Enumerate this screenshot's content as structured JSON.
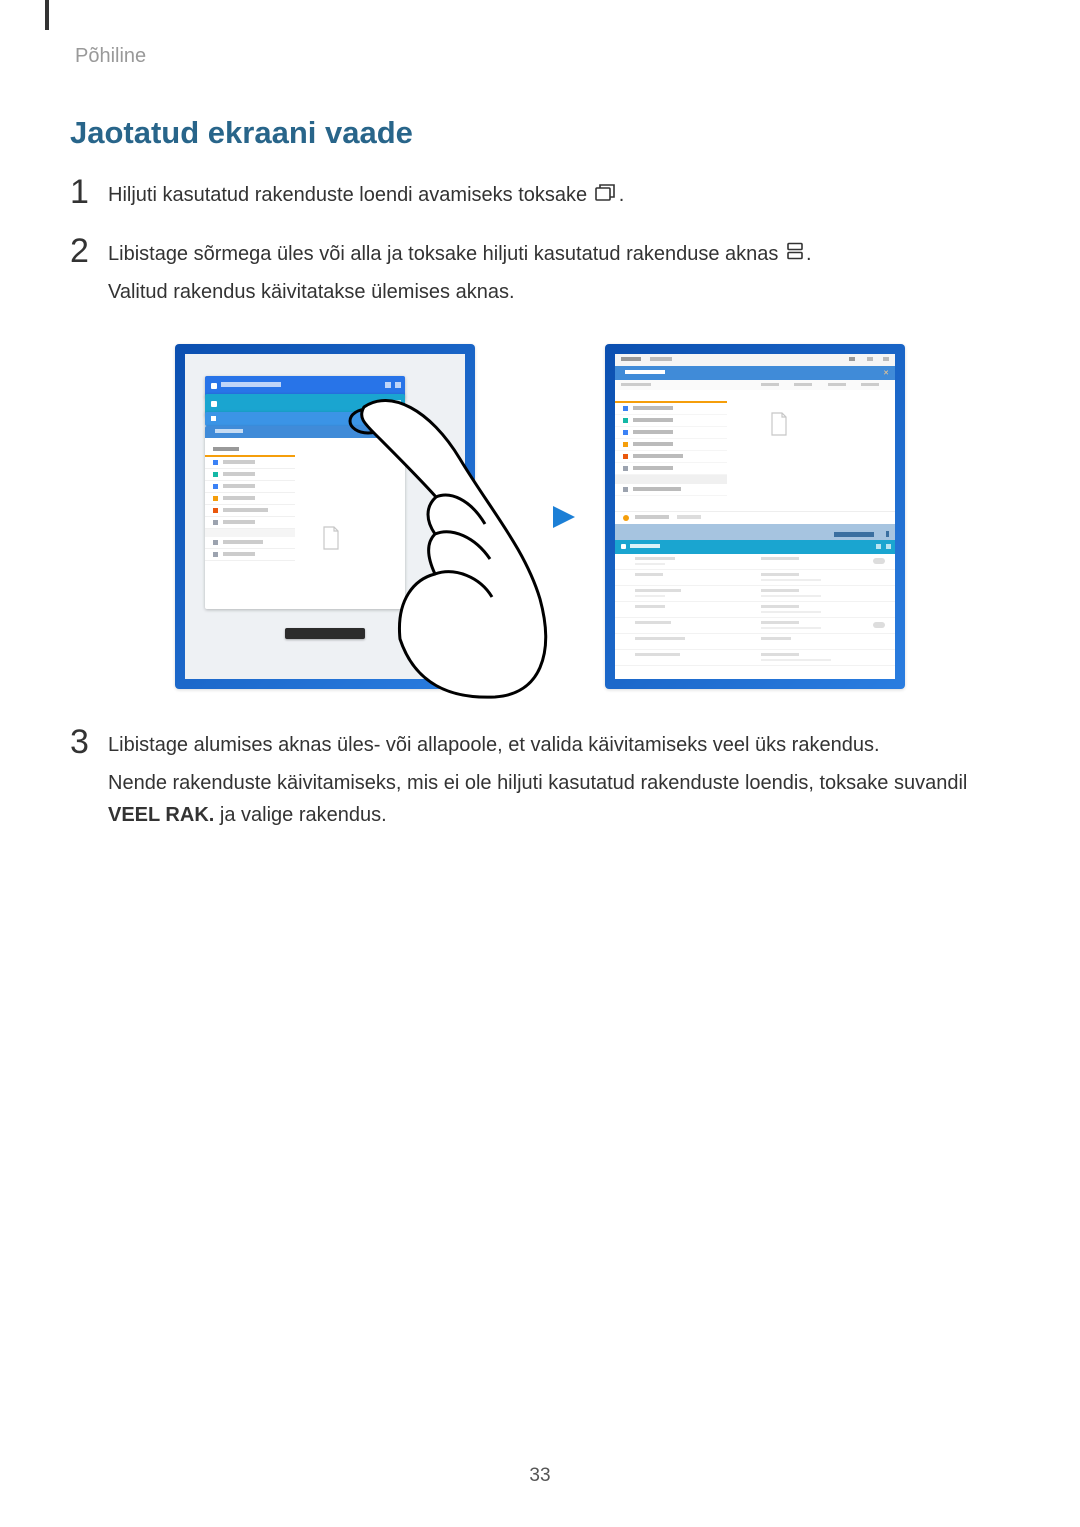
{
  "header": "Põhiline",
  "title": "Jaotatud ekraani vaade",
  "steps": {
    "s1_num": "1",
    "s1_text": "Hiljuti kasutatud rakenduste loendi avamiseks toksake",
    "s1_after": ".",
    "s2_num": "2",
    "s2_text": "Libistage sõrmega üles või alla ja toksake hiljuti kasutatud rakenduse aknas",
    "s2_after": ".",
    "s2_p2": "Valitud rakendus käivitatakse ülemises aknas.",
    "s3_num": "3",
    "s3_text": "Libistage alumises aknas üles- või allapoole, et valida käivitamiseks veel üks rakendus.",
    "s3_p2a": "Nende rakenduste käivitamiseks, mis ei ole hiljuti kasutatud rakenduste loendis, toksake suvandil ",
    "s3_bold": "VEEL RAK.",
    "s3_p2b": " ja valige rakendus."
  },
  "page_number": "33"
}
